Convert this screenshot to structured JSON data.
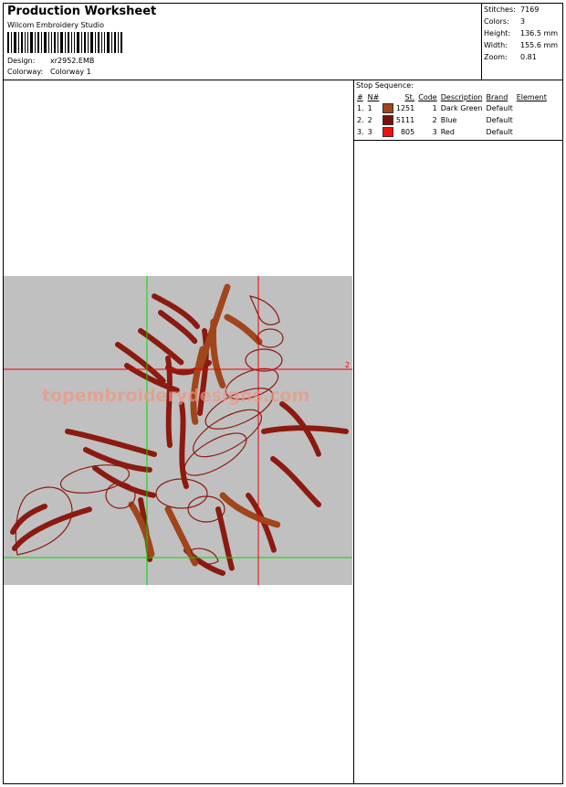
{
  "header": {
    "title": "Production Worksheet",
    "software": "Wilcom  Embroidery Studio",
    "design_label": "Design:",
    "design_value": "xr2952.EMB",
    "colorway_label": "Colorway:",
    "colorway_value": "Colorway 1"
  },
  "stats": {
    "stitches_label": "Stitches:",
    "stitches_value": "7169",
    "colors_label": "Colors:",
    "colors_value": "3",
    "height_label": "Height:",
    "height_value": "136.5 mm",
    "width_label": "Width:",
    "width_value": "155.6 mm",
    "zoom_label": "Zoom:",
    "zoom_value": "0.81"
  },
  "stop_sequence": {
    "title": "Stop Sequence:",
    "columns": [
      "#",
      "N#",
      "St.",
      "Code",
      "Description",
      "Brand",
      "Element"
    ],
    "rows": [
      {
        "num": "1.",
        "n": "1",
        "color": "#a0451c",
        "st": "1251",
        "code": "1",
        "desc": "Dark Green",
        "brand": "Default"
      },
      {
        "num": "2.",
        "n": "2",
        "color": "#7a1010",
        "st": "5111",
        "code": "2",
        "desc": "Blue",
        "brand": "Default"
      },
      {
        "num": "3.",
        "n": "3",
        "color": "#f01010",
        "st": "805",
        "code": "3",
        "desc": "Red",
        "brand": "Default"
      }
    ]
  },
  "design": {
    "watermark": "topembroiderydesigns.com",
    "marker": "2",
    "background": "#c0c0c0",
    "thread_dark": "#8b1a10",
    "thread_brown": "#a0451c",
    "guide_green": "#00dd00",
    "guide_red": "#ee0000"
  }
}
